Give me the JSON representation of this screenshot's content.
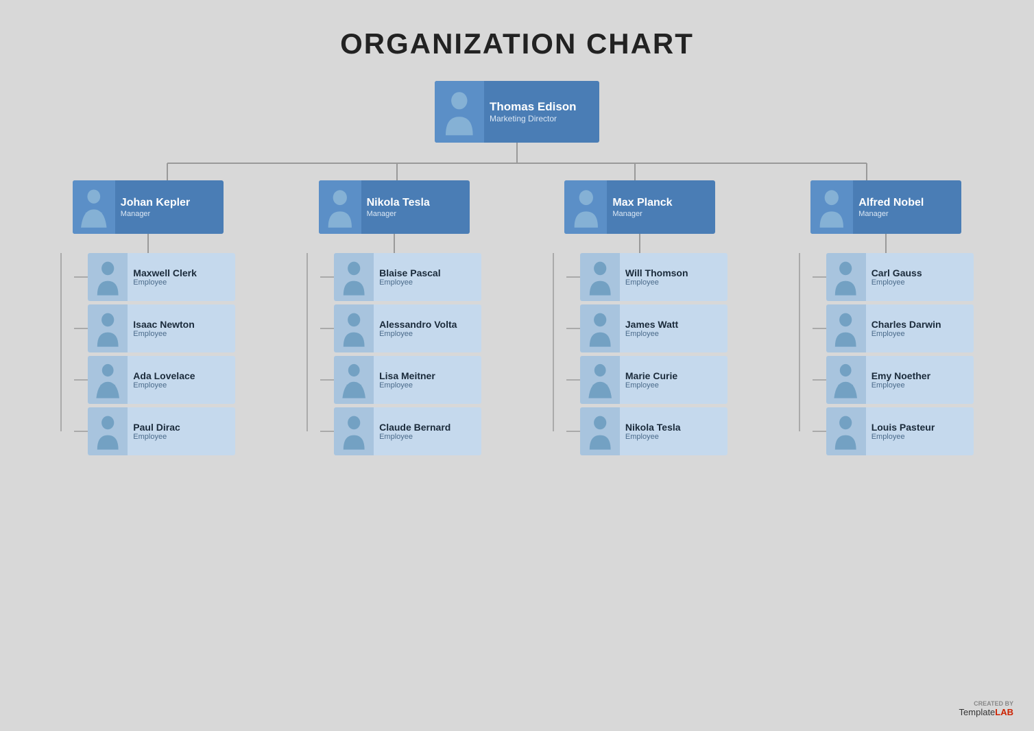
{
  "title": "ORGANIZATION CHART",
  "director": {
    "name": "Thomas Edison",
    "role": "Marketing Director"
  },
  "managers": [
    {
      "name": "Johan Kepler",
      "role": "Manager"
    },
    {
      "name": "Nikola Tesla",
      "role": "Manager"
    },
    {
      "name": "Max Planck",
      "role": "Manager"
    },
    {
      "name": "Alfred Nobel",
      "role": "Manager"
    }
  ],
  "employees": [
    [
      {
        "name": "Maxwell Clerk",
        "role": "Employee"
      },
      {
        "name": "Isaac Newton",
        "role": "Employee"
      },
      {
        "name": "Ada Lovelace",
        "role": "Employee"
      },
      {
        "name": "Paul Dirac",
        "role": "Employee"
      }
    ],
    [
      {
        "name": "Blaise Pascal",
        "role": "Employee"
      },
      {
        "name": "Alessandro Volta",
        "role": "Employee"
      },
      {
        "name": "Lisa Meitner",
        "role": "Employee"
      },
      {
        "name": "Claude Bernard",
        "role": "Employee"
      }
    ],
    [
      {
        "name": "Will Thomson",
        "role": "Employee"
      },
      {
        "name": "James Watt",
        "role": "Employee"
      },
      {
        "name": "Marie Curie",
        "role": "Employee"
      },
      {
        "name": "Nikola Tesla",
        "role": "Employee"
      }
    ],
    [
      {
        "name": "Carl Gauss",
        "role": "Employee"
      },
      {
        "name": "Charles Darwin",
        "role": "Employee"
      },
      {
        "name": "Emy Noether",
        "role": "Employee"
      },
      {
        "name": "Louis Pasteur",
        "role": "Employee"
      }
    ]
  ],
  "watermark": {
    "created_by": "CREATED BY",
    "brand": "Template",
    "brand_accent": "LAB"
  }
}
